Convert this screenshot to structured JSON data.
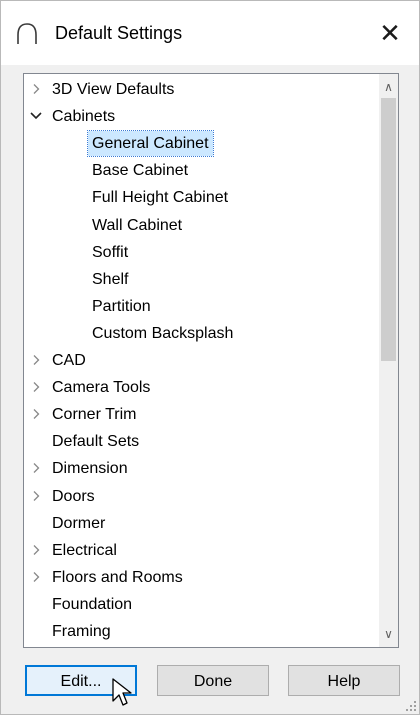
{
  "window": {
    "title": "Default Settings",
    "close_glyph": "✕",
    "icon": "arc-app-icon"
  },
  "tree": {
    "items": [
      {
        "label": "3D View Defaults",
        "expander": "collapsed",
        "level": 0,
        "selected": false
      },
      {
        "label": "Cabinets",
        "expander": "expanded",
        "level": 0,
        "selected": false
      },
      {
        "label": "General Cabinet",
        "expander": "none",
        "level": 1,
        "selected": true
      },
      {
        "label": "Base Cabinet",
        "expander": "none",
        "level": 1,
        "selected": false
      },
      {
        "label": "Full Height Cabinet",
        "expander": "none",
        "level": 1,
        "selected": false
      },
      {
        "label": "Wall Cabinet",
        "expander": "none",
        "level": 1,
        "selected": false
      },
      {
        "label": "Soffit",
        "expander": "none",
        "level": 1,
        "selected": false
      },
      {
        "label": "Shelf",
        "expander": "none",
        "level": 1,
        "selected": false
      },
      {
        "label": "Partition",
        "expander": "none",
        "level": 1,
        "selected": false
      },
      {
        "label": "Custom Backsplash",
        "expander": "none",
        "level": 1,
        "selected": false
      },
      {
        "label": "CAD",
        "expander": "collapsed",
        "level": 0,
        "selected": false
      },
      {
        "label": "Camera Tools",
        "expander": "collapsed",
        "level": 0,
        "selected": false
      },
      {
        "label": "Corner Trim",
        "expander": "collapsed",
        "level": 0,
        "selected": false
      },
      {
        "label": "Default Sets",
        "expander": "none",
        "level": 0,
        "selected": false
      },
      {
        "label": "Dimension",
        "expander": "collapsed",
        "level": 0,
        "selected": false
      },
      {
        "label": "Doors",
        "expander": "collapsed",
        "level": 0,
        "selected": false
      },
      {
        "label": "Dormer",
        "expander": "none",
        "level": 0,
        "selected": false
      },
      {
        "label": "Electrical",
        "expander": "collapsed",
        "level": 0,
        "selected": false
      },
      {
        "label": "Floors and Rooms",
        "expander": "collapsed",
        "level": 0,
        "selected": false
      },
      {
        "label": "Foundation",
        "expander": "none",
        "level": 0,
        "selected": false
      },
      {
        "label": "Framing",
        "expander": "none",
        "level": 0,
        "selected": false
      }
    ],
    "scroll_position": 0.0,
    "visible_fraction": 0.5
  },
  "scrollbar": {
    "up_glyph": "∧",
    "down_glyph": "∨"
  },
  "buttons": {
    "edit_label": "Edit...",
    "done_label": "Done",
    "help_label": "Help"
  },
  "colors": {
    "selection": "#cce8ff",
    "default_button_border": "#0078d7"
  }
}
